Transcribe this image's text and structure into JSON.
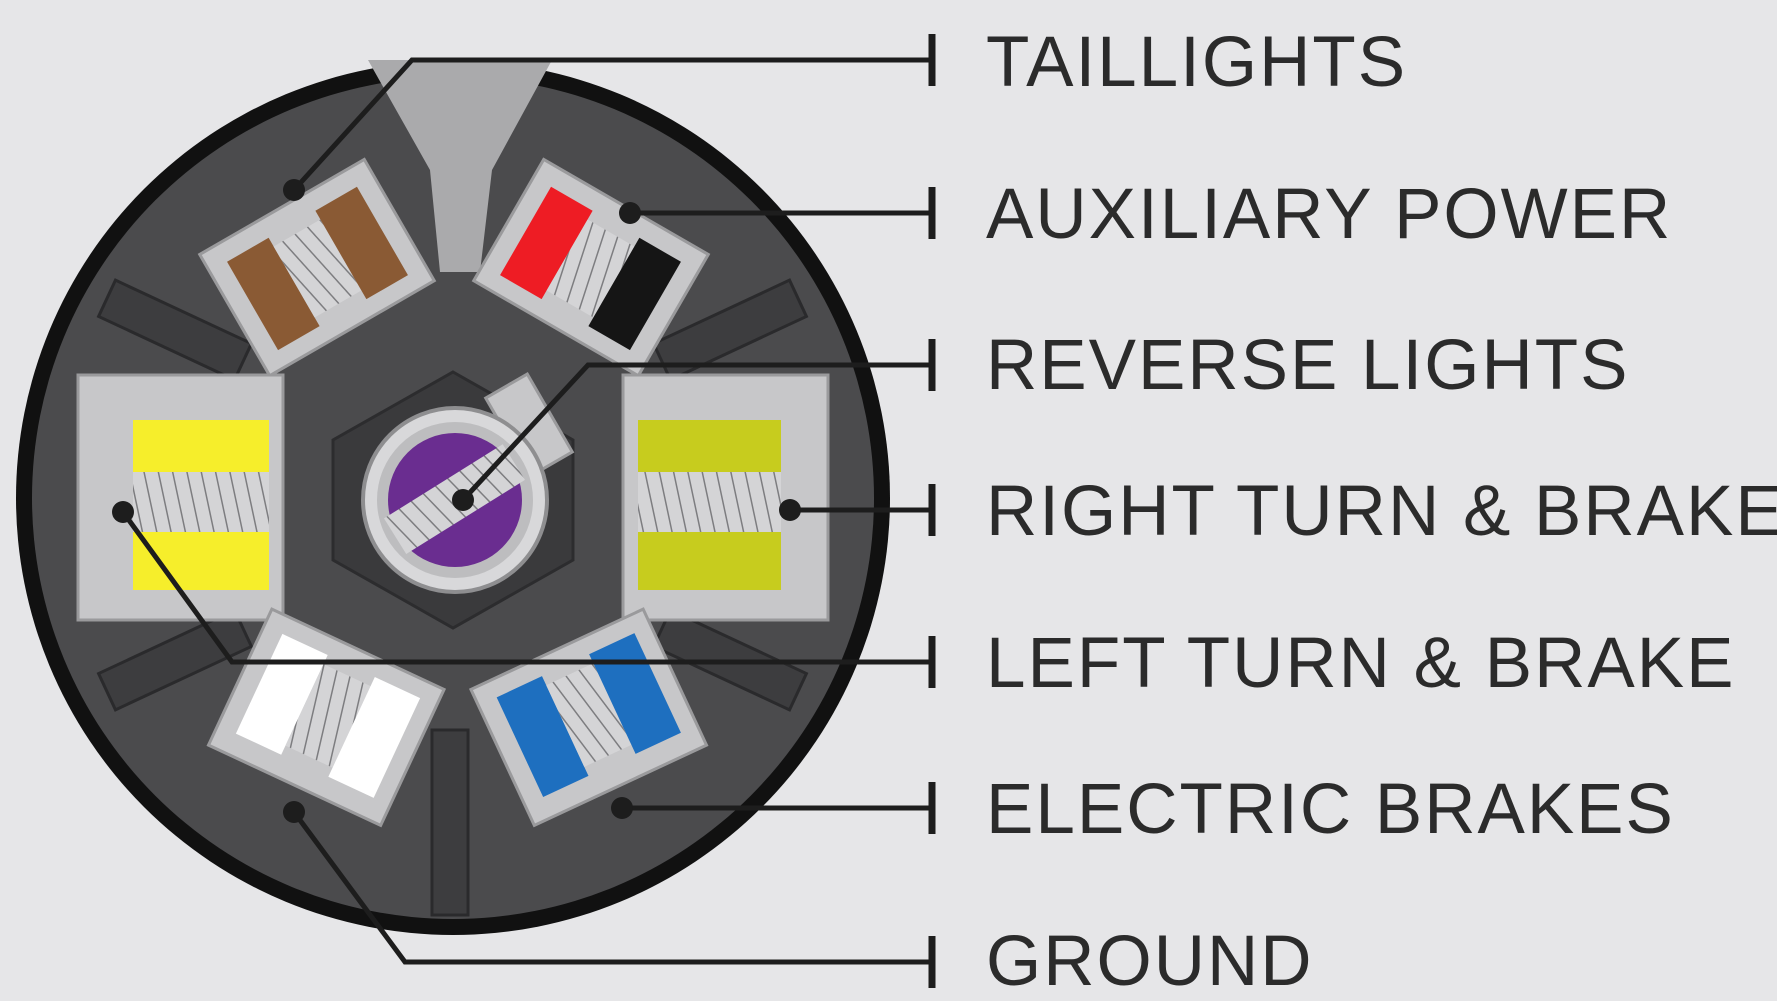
{
  "diagram": {
    "labels": {
      "taillights": "TAILLIGHTS",
      "auxiliary_power": "AUXILIARY POWER",
      "reverse_lights": "REVERSE LIGHTS",
      "right_turn_brake": "RIGHT TURN & BRAKE",
      "left_turn_brake": "LEFT TURN & BRAKE",
      "electric_brakes": "ELECTRIC BRAKES",
      "ground": "GROUND"
    },
    "wire_colors": {
      "taillights": "#8a5a34",
      "auxiliary_power_pos": "#ee1c24",
      "auxiliary_power_neg": "#151515",
      "reverse_lights": "#6a2d90",
      "right_turn_brake": "#c7cc1e",
      "left_turn_brake": "#f6ee2b",
      "electric_brakes": "#1e6fbf",
      "ground": "#ffffff"
    },
    "colors": {
      "background": "#e6e6e8",
      "plug_body": "#4b4b4d",
      "plug_rim": "#111111",
      "terminal_metal": "#c7c7c9",
      "leader_line": "#1d1d1d"
    }
  }
}
